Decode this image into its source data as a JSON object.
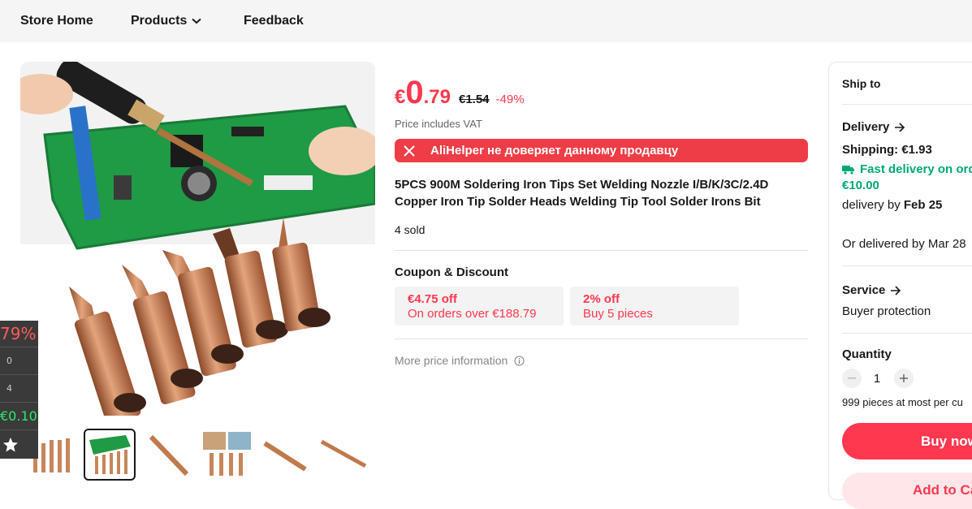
{
  "nav": {
    "store_home": "Store Home",
    "products": "Products",
    "feedback": "Feedback"
  },
  "price": {
    "currency": "€",
    "integer": "0",
    "decimal": ".79",
    "original": "€1.54",
    "discount": "-49%",
    "vat_note": "Price includes VAT"
  },
  "warning": {
    "text": "AliHelper не доверяет данному продавцу"
  },
  "product": {
    "title": "5PCS 900M Soldering Iron Tips Set Welding Nozzle I/B/K/3C/2.4D Copper Iron Tip Solder Heads Welding Tip Tool Solder Irons Bit",
    "sold": "4 sold"
  },
  "coupons": {
    "heading": "Coupon & Discount",
    "items": [
      {
        "amount": "€4.75 off",
        "condition": "On orders over €188.79"
      },
      {
        "amount": "2% off",
        "condition": "Buy 5 pieces"
      }
    ]
  },
  "more_info": "More price information",
  "side_widget": {
    "percent": "79%",
    "row1": "0",
    "row2": "4",
    "price": "€0.10"
  },
  "panel": {
    "ship_to": "Ship to",
    "delivery": "Delivery",
    "shipping": "Shipping: €1.93",
    "fast_delivery": "Fast delivery on ord",
    "fast_price": "€10.00",
    "delivery_by_prefix": "delivery by ",
    "delivery_by_date": "Feb 25",
    "or_delivered": "Or delivered by Mar 28",
    "service": "Service",
    "buyer_protection": "Buyer protection",
    "quantity_label": "Quantity",
    "quantity_value": "1",
    "max_note": "999 pieces at most per cu",
    "buy_now": "Buy now",
    "add_to_cart": "Add to Ca"
  },
  "colors": {
    "accent": "#fd384f",
    "warning": "#ef3d47",
    "green": "#01a971"
  },
  "icons": [
    "chevron-down-icon",
    "close-icon",
    "info-icon",
    "arrow-right-icon",
    "truck-icon",
    "minus-icon",
    "plus-icon",
    "star-icon"
  ]
}
